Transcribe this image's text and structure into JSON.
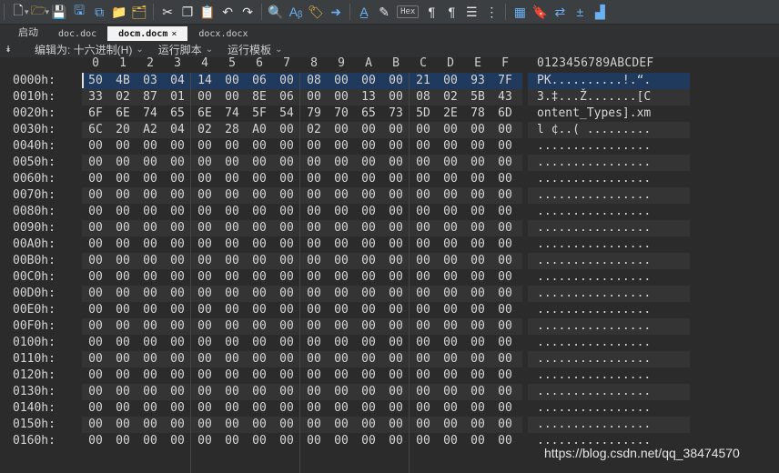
{
  "toolbar": {
    "hex_label": "Hex"
  },
  "tabs": {
    "start": "启动",
    "items": [
      {
        "label": "doc.doc",
        "active": false
      },
      {
        "label": "docm.docm",
        "active": true,
        "close": "×"
      },
      {
        "label": "docx.docx",
        "active": false
      }
    ]
  },
  "infobar": {
    "edit_as": "编辑为: 十六进制(H)",
    "run_script": "运行脚本",
    "run_template": "运行模板"
  },
  "hex": {
    "columns": [
      "0",
      "1",
      "2",
      "3",
      "4",
      "5",
      "6",
      "7",
      "8",
      "9",
      "A",
      "B",
      "C",
      "D",
      "E",
      "F"
    ],
    "ascii_header": "0123456789ABCDEF",
    "rows": [
      {
        "offset": "0000h:",
        "bytes": [
          "50",
          "4B",
          "03",
          "04",
          "14",
          "00",
          "06",
          "00",
          "08",
          "00",
          "00",
          "00",
          "21",
          "00",
          "93",
          "7F"
        ],
        "ascii": "PK..........!.“."
      },
      {
        "offset": "0010h:",
        "bytes": [
          "33",
          "02",
          "87",
          "01",
          "00",
          "00",
          "8E",
          "06",
          "00",
          "00",
          "13",
          "00",
          "08",
          "02",
          "5B",
          "43"
        ],
        "ascii": "3.‡...Ž.......[C"
      },
      {
        "offset": "0020h:",
        "bytes": [
          "6F",
          "6E",
          "74",
          "65",
          "6E",
          "74",
          "5F",
          "54",
          "79",
          "70",
          "65",
          "73",
          "5D",
          "2E",
          "78",
          "6D"
        ],
        "ascii": "ontent_Types].xm"
      },
      {
        "offset": "0030h:",
        "bytes": [
          "6C",
          "20",
          "A2",
          "04",
          "02",
          "28",
          "A0",
          "00",
          "02",
          "00",
          "00",
          "00",
          "00",
          "00",
          "00",
          "00"
        ],
        "ascii": "l ¢..( ........."
      },
      {
        "offset": "0040h:",
        "bytes": [
          "00",
          "00",
          "00",
          "00",
          "00",
          "00",
          "00",
          "00",
          "00",
          "00",
          "00",
          "00",
          "00",
          "00",
          "00",
          "00"
        ],
        "ascii": "................"
      },
      {
        "offset": "0050h:",
        "bytes": [
          "00",
          "00",
          "00",
          "00",
          "00",
          "00",
          "00",
          "00",
          "00",
          "00",
          "00",
          "00",
          "00",
          "00",
          "00",
          "00"
        ],
        "ascii": "................"
      },
      {
        "offset": "0060h:",
        "bytes": [
          "00",
          "00",
          "00",
          "00",
          "00",
          "00",
          "00",
          "00",
          "00",
          "00",
          "00",
          "00",
          "00",
          "00",
          "00",
          "00"
        ],
        "ascii": "................"
      },
      {
        "offset": "0070h:",
        "bytes": [
          "00",
          "00",
          "00",
          "00",
          "00",
          "00",
          "00",
          "00",
          "00",
          "00",
          "00",
          "00",
          "00",
          "00",
          "00",
          "00"
        ],
        "ascii": "................"
      },
      {
        "offset": "0080h:",
        "bytes": [
          "00",
          "00",
          "00",
          "00",
          "00",
          "00",
          "00",
          "00",
          "00",
          "00",
          "00",
          "00",
          "00",
          "00",
          "00",
          "00"
        ],
        "ascii": "................"
      },
      {
        "offset": "0090h:",
        "bytes": [
          "00",
          "00",
          "00",
          "00",
          "00",
          "00",
          "00",
          "00",
          "00",
          "00",
          "00",
          "00",
          "00",
          "00",
          "00",
          "00"
        ],
        "ascii": "................"
      },
      {
        "offset": "00A0h:",
        "bytes": [
          "00",
          "00",
          "00",
          "00",
          "00",
          "00",
          "00",
          "00",
          "00",
          "00",
          "00",
          "00",
          "00",
          "00",
          "00",
          "00"
        ],
        "ascii": "................"
      },
      {
        "offset": "00B0h:",
        "bytes": [
          "00",
          "00",
          "00",
          "00",
          "00",
          "00",
          "00",
          "00",
          "00",
          "00",
          "00",
          "00",
          "00",
          "00",
          "00",
          "00"
        ],
        "ascii": "................"
      },
      {
        "offset": "00C0h:",
        "bytes": [
          "00",
          "00",
          "00",
          "00",
          "00",
          "00",
          "00",
          "00",
          "00",
          "00",
          "00",
          "00",
          "00",
          "00",
          "00",
          "00"
        ],
        "ascii": "................"
      },
      {
        "offset": "00D0h:",
        "bytes": [
          "00",
          "00",
          "00",
          "00",
          "00",
          "00",
          "00",
          "00",
          "00",
          "00",
          "00",
          "00",
          "00",
          "00",
          "00",
          "00"
        ],
        "ascii": "................"
      },
      {
        "offset": "00E0h:",
        "bytes": [
          "00",
          "00",
          "00",
          "00",
          "00",
          "00",
          "00",
          "00",
          "00",
          "00",
          "00",
          "00",
          "00",
          "00",
          "00",
          "00"
        ],
        "ascii": "................"
      },
      {
        "offset": "00F0h:",
        "bytes": [
          "00",
          "00",
          "00",
          "00",
          "00",
          "00",
          "00",
          "00",
          "00",
          "00",
          "00",
          "00",
          "00",
          "00",
          "00",
          "00"
        ],
        "ascii": "................"
      },
      {
        "offset": "0100h:",
        "bytes": [
          "00",
          "00",
          "00",
          "00",
          "00",
          "00",
          "00",
          "00",
          "00",
          "00",
          "00",
          "00",
          "00",
          "00",
          "00",
          "00"
        ],
        "ascii": "................"
      },
      {
        "offset": "0110h:",
        "bytes": [
          "00",
          "00",
          "00",
          "00",
          "00",
          "00",
          "00",
          "00",
          "00",
          "00",
          "00",
          "00",
          "00",
          "00",
          "00",
          "00"
        ],
        "ascii": "................"
      },
      {
        "offset": "0120h:",
        "bytes": [
          "00",
          "00",
          "00",
          "00",
          "00",
          "00",
          "00",
          "00",
          "00",
          "00",
          "00",
          "00",
          "00",
          "00",
          "00",
          "00"
        ],
        "ascii": "................"
      },
      {
        "offset": "0130h:",
        "bytes": [
          "00",
          "00",
          "00",
          "00",
          "00",
          "00",
          "00",
          "00",
          "00",
          "00",
          "00",
          "00",
          "00",
          "00",
          "00",
          "00"
        ],
        "ascii": "................"
      },
      {
        "offset": "0140h:",
        "bytes": [
          "00",
          "00",
          "00",
          "00",
          "00",
          "00",
          "00",
          "00",
          "00",
          "00",
          "00",
          "00",
          "00",
          "00",
          "00",
          "00"
        ],
        "ascii": "................"
      },
      {
        "offset": "0150h:",
        "bytes": [
          "00",
          "00",
          "00",
          "00",
          "00",
          "00",
          "00",
          "00",
          "00",
          "00",
          "00",
          "00",
          "00",
          "00",
          "00",
          "00"
        ],
        "ascii": "................"
      },
      {
        "offset": "0160h:",
        "bytes": [
          "00",
          "00",
          "00",
          "00",
          "00",
          "00",
          "00",
          "00",
          "00",
          "00",
          "00",
          "00",
          "00",
          "00",
          "00",
          "00"
        ],
        "ascii": "................"
      }
    ]
  },
  "watermark": "https://blog.csdn.net/qq_38474570"
}
